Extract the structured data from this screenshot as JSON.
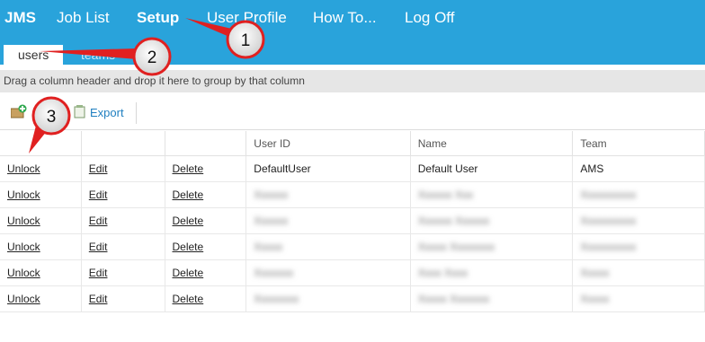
{
  "brand": "JMS",
  "nav": {
    "items": [
      "Job List",
      "Setup",
      "User Profile",
      "How To...",
      "Log Off"
    ],
    "active": "Setup"
  },
  "tabs": [
    {
      "label": "users",
      "active": true
    },
    {
      "label": "teams",
      "active": false
    }
  ],
  "group_hint": "Drag a column header and drop it here to group by that column",
  "toolbar": {
    "export_label": "Export",
    "add_icon": "add-icon",
    "export_icon": "export-icon"
  },
  "grid": {
    "columns": [
      "",
      "",
      "",
      "User ID",
      "Name",
      "Team"
    ],
    "action_labels": {
      "unlock": "Unlock",
      "edit": "Edit",
      "delete": "Delete"
    },
    "rows": [
      {
        "user_id": "DefaultUser",
        "name": "Default User",
        "team": "AMS"
      },
      {
        "user_id": "Xxxxxx",
        "name": "Xxxxxx Xxx",
        "team": "Xxxxxxxxxx"
      },
      {
        "user_id": "Xxxxxx",
        "name": "Xxxxxx Xxxxxx",
        "team": "Xxxxxxxxxx"
      },
      {
        "user_id": "Xxxxx",
        "name": "Xxxxx Xxxxxxxx",
        "team": "Xxxxxxxxxx"
      },
      {
        "user_id": "Xxxxxxx",
        "name": "Xxxx Xxxx",
        "team": "Xxxxx"
      },
      {
        "user_id": "Xxxxxxxx",
        "name": "Xxxxx Xxxxxxx",
        "team": "Xxxxx"
      }
    ]
  },
  "annotations": [
    "1",
    "2",
    "3"
  ],
  "colors": {
    "accent": "#29a3db",
    "callout_red": "#e02020"
  }
}
